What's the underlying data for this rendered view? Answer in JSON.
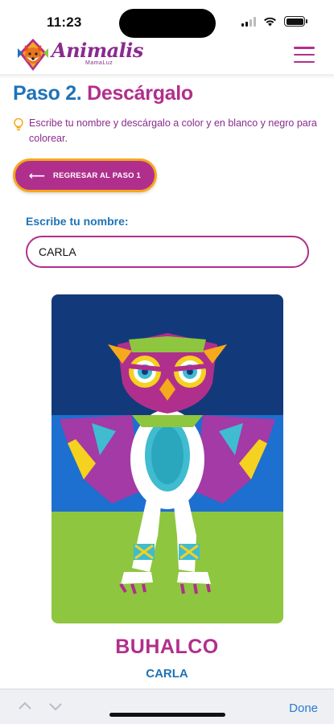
{
  "status": {
    "time": "11:23"
  },
  "header": {
    "logo_text": "Animalis",
    "logo_sub": "MamaLuz"
  },
  "step": {
    "number": "Paso 2.",
    "title": "Descárgalo"
  },
  "hint": {
    "text": "Escribe tu nombre y descárgalo a color y en blanco y negro para colorear."
  },
  "back_button": {
    "label": "REGRESAR AL PASO 1"
  },
  "name_field": {
    "label": "Escribe tu nombre:",
    "value": "CARLA"
  },
  "card": {
    "animal": "BUHALCO",
    "owner": "CARLA"
  },
  "keyboard_bar": {
    "done": "Done"
  },
  "colors": {
    "magenta": "#b12f8c",
    "blue": "#1f73b7",
    "orange": "#f6a91b",
    "green": "#8ec63f",
    "navy": "#123a7a"
  }
}
